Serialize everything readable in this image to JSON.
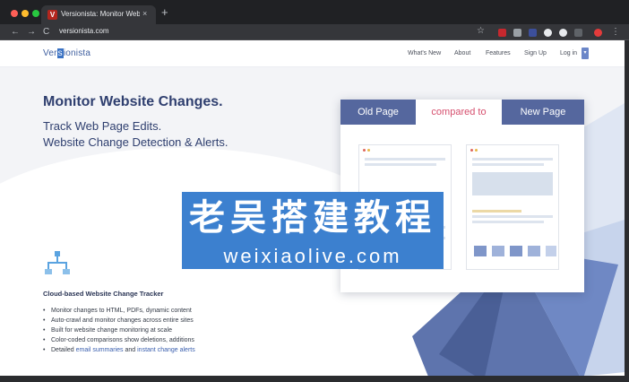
{
  "browser": {
    "tab_title": "Versionista: Monitor Website C",
    "tab_favicon": "V",
    "tab_close": "×",
    "new_tab": "+",
    "url": "versionista.com",
    "back_icon": "arrow-left-icon",
    "forward_icon": "arrow-right-icon",
    "reload_icon": "reload-icon",
    "star_icon": "star-icon",
    "menu_icon": "kebab-menu-icon",
    "nav_back": "←",
    "nav_forward": "→",
    "nav_reload": "C",
    "star": "☆",
    "menu": "⋮"
  },
  "site": {
    "logo_pre": "Ver",
    "logo_hl": "s",
    "logo_post": "ionista",
    "nav": [
      "What's New",
      "About",
      "Features",
      "Sign Up",
      "Log in"
    ],
    "nav_toggle": "▾"
  },
  "hero": {
    "title": "Monitor Website Changes.",
    "line1": "Track Web Page Edits.",
    "line2": "Website Change Detection & Alerts."
  },
  "compare": {
    "old": "Old Page",
    "mid": "compared to",
    "new": "New Page"
  },
  "watermark": {
    "cn": "老吴搭建教程",
    "en": "weixiaolive.com"
  },
  "features": {
    "title": "Cloud-based Website Change Tracker",
    "items": [
      "Monitor changes to HTML, PDFs, dynamic content",
      "Auto-crawl and monitor changes across entire sites",
      "Built for website change monitoring at scale",
      "Color-coded comparisons show deletions, additions"
    ],
    "last_pre": "Detailed ",
    "last_link1": "email summaries",
    "last_mid": " and ",
    "last_link2": "instant change alerts"
  },
  "colors": {
    "accent": "#55679e",
    "heading": "#2f3f6f",
    "compare_text": "#d64f6e",
    "watermark": "#3c80cf"
  }
}
